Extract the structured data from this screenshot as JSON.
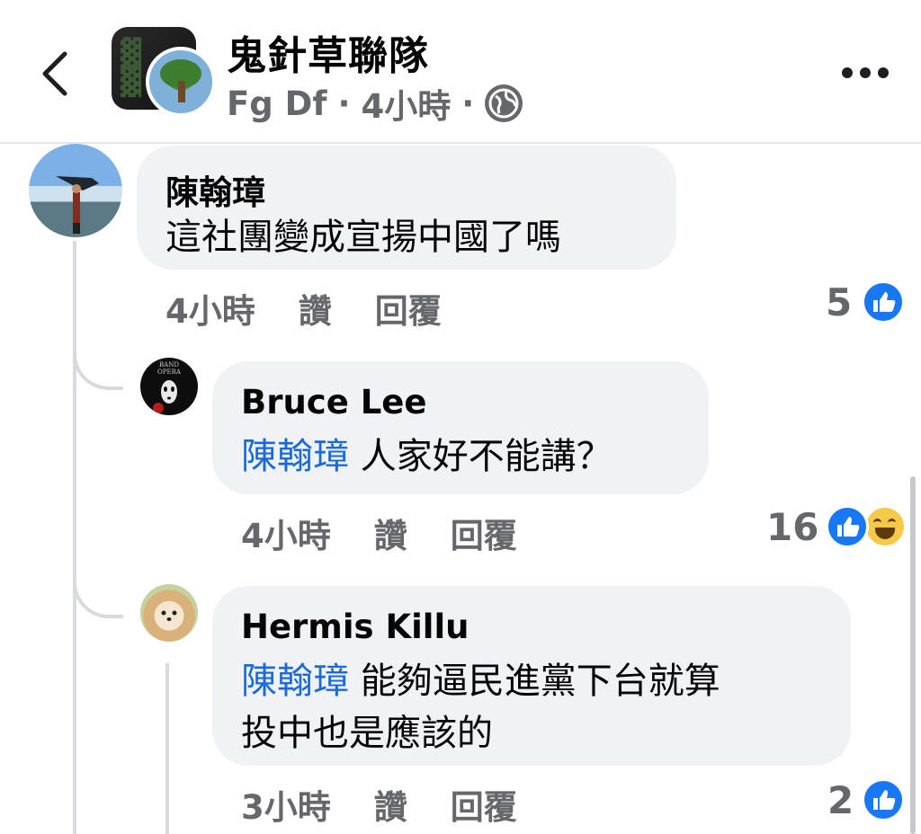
{
  "header": {
    "group_name": "鬼針草聯隊",
    "poster_name": "Fg Df",
    "time": "4小時",
    "sep1": "·",
    "sep2": "·",
    "privacy_icon": "globe-icon",
    "back_icon": "chevron-left-icon",
    "more_icon": "more-horizontal-icon"
  },
  "comments": [
    {
      "author": "陳翰璋",
      "text": "這社團變成宣揚中國了嗎",
      "time": "4小時",
      "like_label": "讚",
      "reply_label": "回覆",
      "reaction_count": "5",
      "reactions": [
        "like"
      ]
    },
    {
      "author": "Bruce Lee",
      "mention": "陳翰璋",
      "text": "人家好不能講？",
      "time": "4小時",
      "like_label": "讚",
      "reply_label": "回覆",
      "reaction_count": "16",
      "reactions": [
        "like",
        "haha"
      ]
    },
    {
      "author": "Hermis Killu",
      "mention": "陳翰璋",
      "text_line1": "能夠逼民進黨下台就算",
      "text_line2": "投中也是應該的",
      "time": "3小時",
      "like_label": "讚",
      "reply_label": "回覆",
      "reaction_count": "2",
      "reactions": [
        "like"
      ]
    }
  ],
  "colors": {
    "bubble": "#f0f2f5",
    "mention": "#1a6ad9",
    "secondary_text": "#65676b",
    "like_blue": "#1877f2",
    "thread_line": "#d8dadf"
  }
}
